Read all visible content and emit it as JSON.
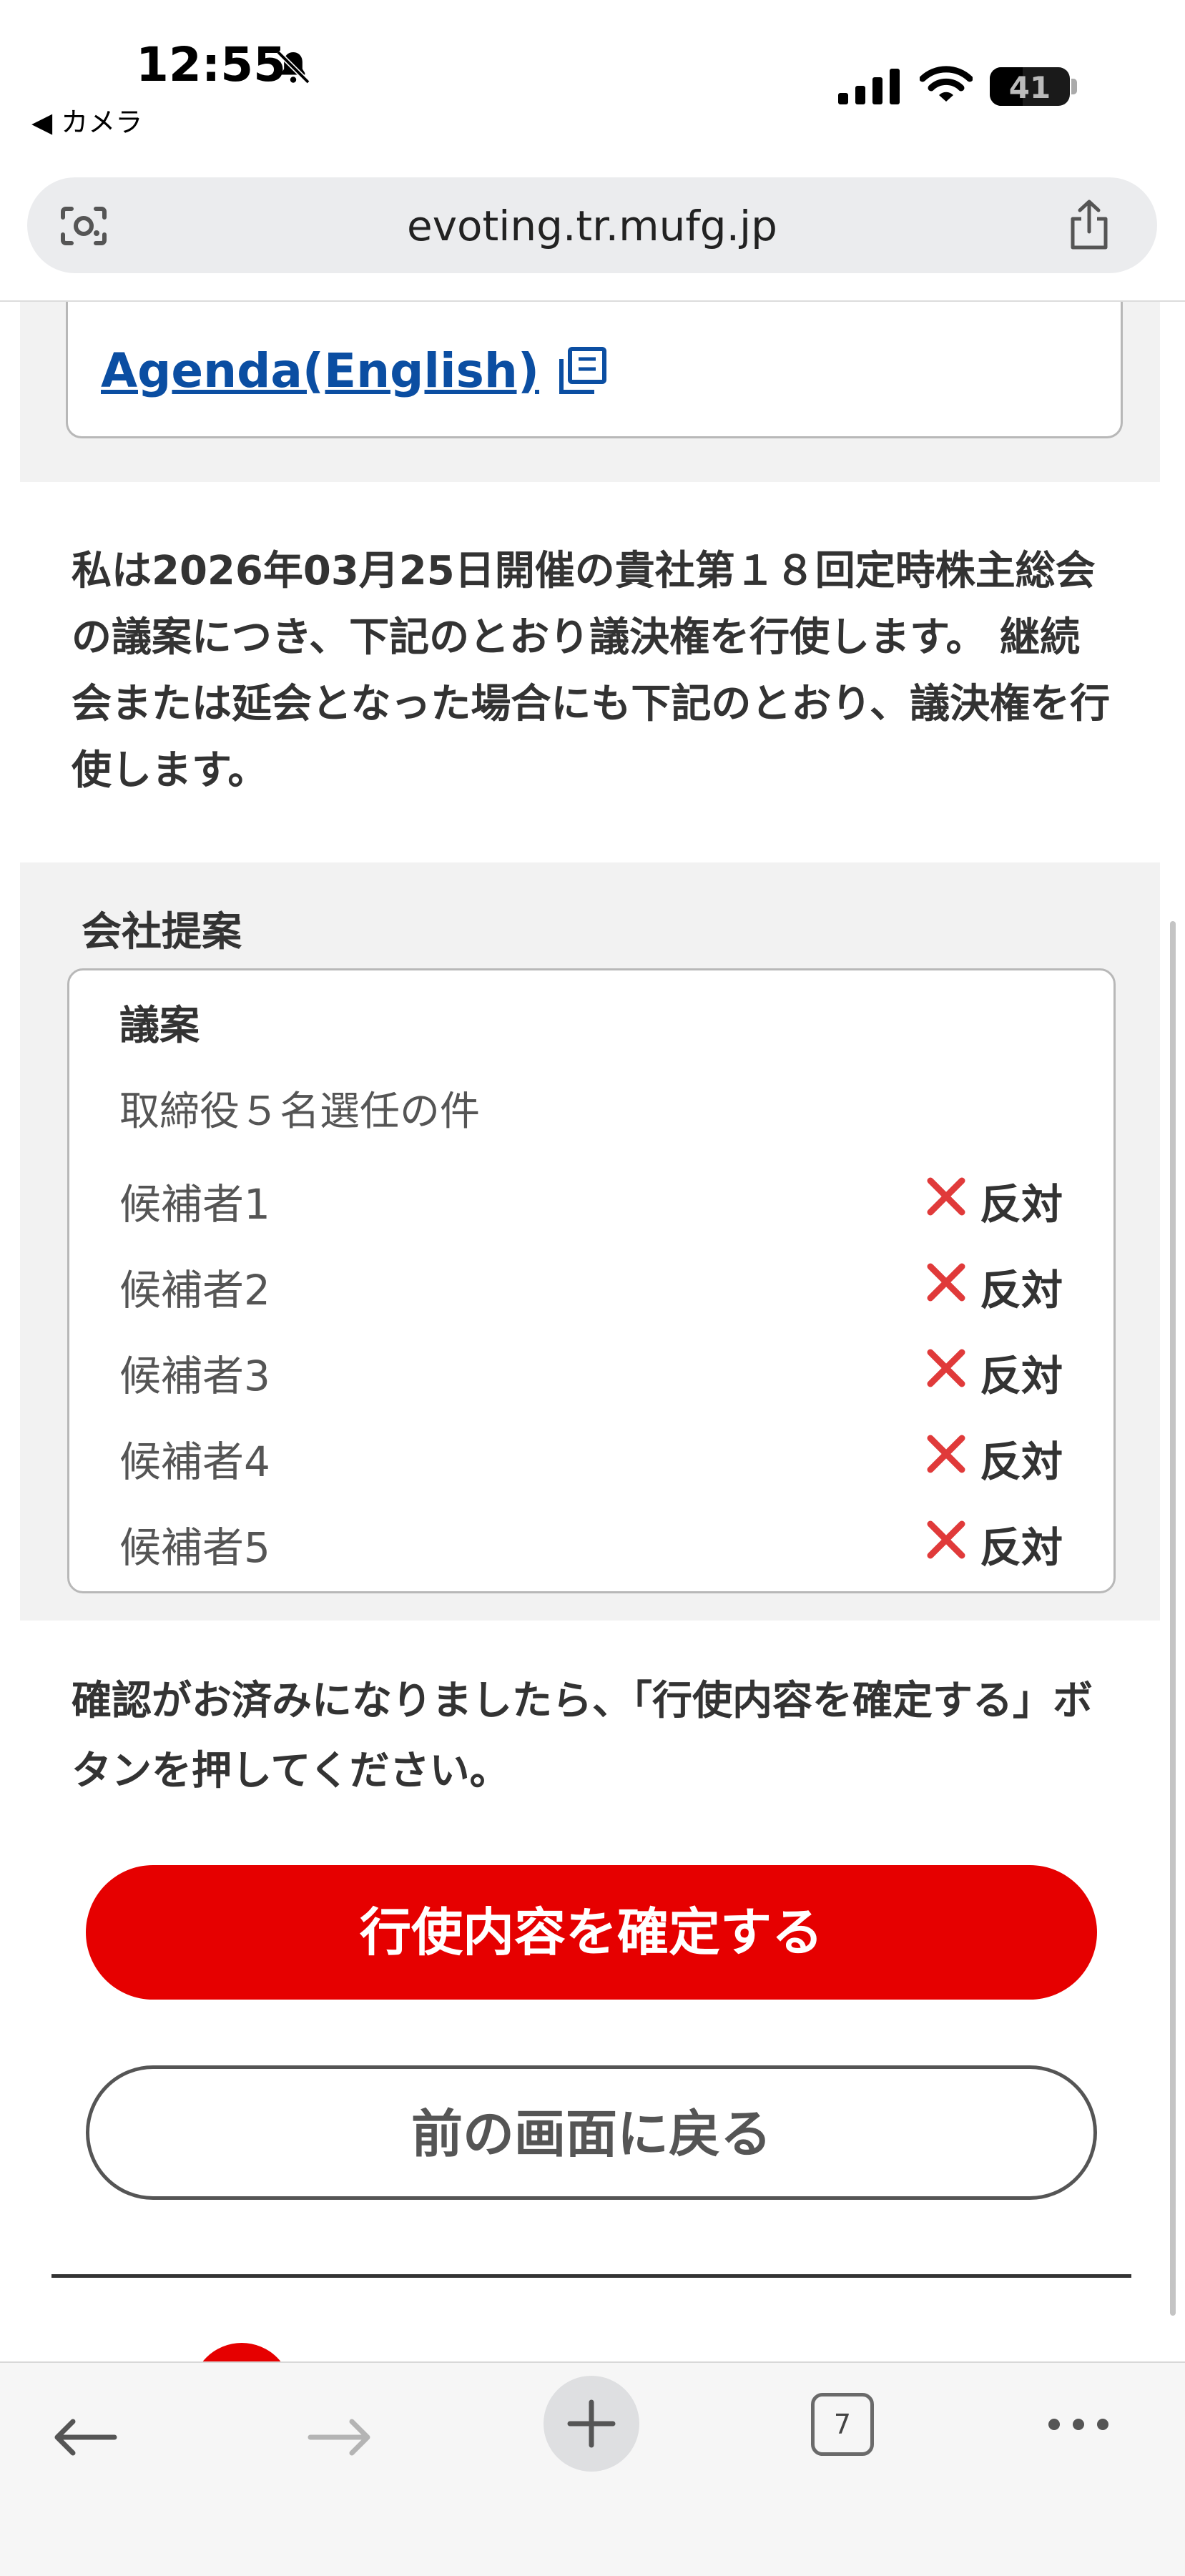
{
  "status_bar": {
    "time": "12:55",
    "back_app": "◀ カメラ",
    "battery": "41",
    "battery_fraction": 0.41,
    "icons": [
      "bell-slash-icon",
      "signal-icon",
      "wifi-icon",
      "battery-icon"
    ]
  },
  "browser": {
    "url": "evoting.tr.mufg.jp",
    "icons": [
      "lens-icon",
      "share-icon"
    ],
    "tab_count": "7",
    "toolbar_icons": [
      "back-arrow-icon",
      "forward-arrow-icon",
      "plus-icon",
      "tabs-icon",
      "more-icon"
    ]
  },
  "agenda": {
    "link_label": "Agenda(English)",
    "link_icon": "copy-icon",
    "link_color": "#0b4ea2"
  },
  "declaration": "私は2026年03月25日開催の貴社第１８回定時株主総会の議案につき、下記のとおり議決権を行使します。 継続会または延会となった場合にも下記のとおり、議決権を行使します。",
  "company_proposal": {
    "title": "会社提案",
    "header": "議案",
    "item_title": "取締役５名選任の件",
    "vote_icon": "cross-icon",
    "vote_icon_color": "#e03a3a",
    "candidates": [
      {
        "name": "候補者1",
        "vote": "反対"
      },
      {
        "name": "候補者2",
        "vote": "反対"
      },
      {
        "name": "候補者3",
        "vote": "反対"
      },
      {
        "name": "候補者4",
        "vote": "反対"
      },
      {
        "name": "候補者5",
        "vote": "反対"
      }
    ]
  },
  "instruction": "確認がお済みになりましたら、「行使内容を確定する」ボタンを押してください。",
  "buttons": {
    "confirm": "行使内容を確定する",
    "confirm_color": "#e60000",
    "back": "前の画面に戻る"
  }
}
